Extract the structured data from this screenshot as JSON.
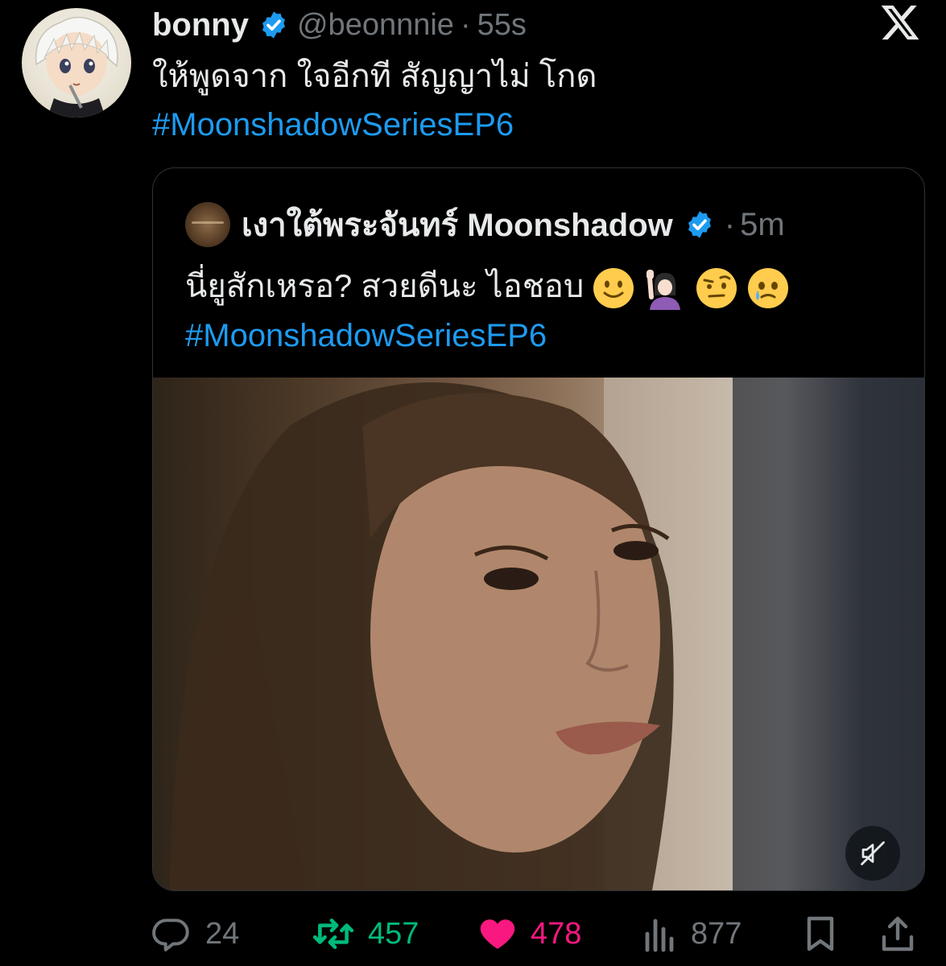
{
  "tweet": {
    "author_name": "bonny",
    "handle": "@beonnnie",
    "separator": "·",
    "time": "55s",
    "text": "ให้พูดจาก ใจอีกที สัญญาไม่ โกด",
    "hashtag": "#MoonshadowSeriesEP6"
  },
  "quote": {
    "author_name": "เงาใต้พระจันทร์ Moonshadow",
    "separator": "·",
    "time": "5m",
    "text": "นี่ยูสักเหรอ? สวยดีนะ ไอชอบ",
    "emojis": [
      "slightly-smiling-face",
      "person-raising-hand",
      "face-with-raised-eyebrow",
      "face-holding-back-tears"
    ],
    "hashtag": "#MoonshadowSeriesEP6"
  },
  "actions": {
    "replies": "24",
    "reposts": "457",
    "likes": "478",
    "views": "877"
  },
  "icons": {
    "logo": "x-logo-icon",
    "verified": "verified-badge-icon",
    "mute": "mute-icon",
    "reply": "reply-icon",
    "repost": "repost-icon",
    "like": "heart-icon",
    "views": "views-icon",
    "bookmark": "bookmark-icon",
    "share": "share-icon"
  },
  "colors": {
    "background": "#000000",
    "text": "#e7e9ea",
    "muted": "#71767b",
    "link": "#1d9bf0",
    "verified": "#1d9bf0",
    "repost": "#00ba7c",
    "like": "#f91880"
  }
}
